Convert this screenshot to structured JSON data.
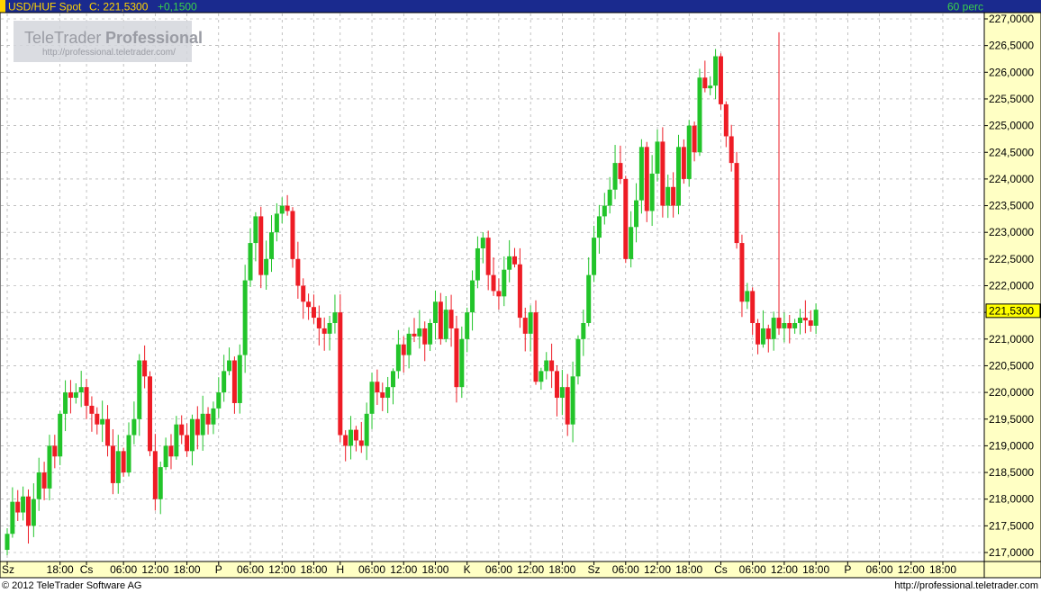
{
  "header": {
    "symbol": "USD/HUF Spot",
    "close_label": "C: 221,5300",
    "change": "+0,1500",
    "interval": "60 perc"
  },
  "watermark": {
    "brand_regular": "TeleTrader",
    "brand_bold": "Professional",
    "url": "http://professional.teletrader.com/"
  },
  "footer": {
    "copyright": "© 2012 TeleTrader Software AG",
    "url": "http://professional.teletrader.com"
  },
  "colors": {
    "header_bg": "#1a2a8e",
    "header_symbol": "#ffd400",
    "header_change": "#3ad14a",
    "axis_bg": "#ffffc4",
    "up": "#22c42a",
    "down": "#ee1c25",
    "price_label_bg": "#ffff00"
  },
  "chart_data": {
    "type": "candlestick",
    "y_min": 216.8,
    "y_max": 227.1,
    "grid": true,
    "last_price": 221.53,
    "last_price_label": "221,5300",
    "y_ticks": [
      {
        "value": 217.0,
        "label": "217,0000"
      },
      {
        "value": 217.5,
        "label": "217,5000"
      },
      {
        "value": 218.0,
        "label": "218,0000"
      },
      {
        "value": 218.5,
        "label": "218,5000"
      },
      {
        "value": 219.0,
        "label": "219,0000"
      },
      {
        "value": 219.5,
        "label": "219,5000"
      },
      {
        "value": 220.0,
        "label": "220,0000"
      },
      {
        "value": 220.5,
        "label": "220,5000"
      },
      {
        "value": 221.0,
        "label": "221,0000"
      },
      {
        "value": 221.5,
        "label": "221,5000"
      },
      {
        "value": 222.0,
        "label": "222,0000"
      },
      {
        "value": 222.5,
        "label": "222,5000"
      },
      {
        "value": 223.0,
        "label": "223,0000"
      },
      {
        "value": 223.5,
        "label": "223,5000"
      },
      {
        "value": 224.0,
        "label": "224,0000"
      },
      {
        "value": 224.5,
        "label": "224,5000"
      },
      {
        "value": 225.0,
        "label": "225,0000"
      },
      {
        "value": 225.5,
        "label": "225,5000"
      },
      {
        "value": 226.0,
        "label": "226,0000"
      },
      {
        "value": 226.5,
        "label": "226,5000"
      },
      {
        "value": 227.0,
        "label": "227,0000"
      }
    ],
    "x_ticks": [
      {
        "index": 0,
        "label": "Sz"
      },
      {
        "index": 10,
        "label": "18:00"
      },
      {
        "index": 15,
        "label": "Cs"
      },
      {
        "index": 22,
        "label": "06:00"
      },
      {
        "index": 28,
        "label": "12:00"
      },
      {
        "index": 34,
        "label": "18:00"
      },
      {
        "index": 40,
        "label": "P"
      },
      {
        "index": 46,
        "label": "06:00"
      },
      {
        "index": 52,
        "label": "12:00"
      },
      {
        "index": 58,
        "label": "18:00"
      },
      {
        "index": 63,
        "label": "H"
      },
      {
        "index": 69,
        "label": "06:00"
      },
      {
        "index": 75,
        "label": "12:00"
      },
      {
        "index": 81,
        "label": "18:00"
      },
      {
        "index": 87,
        "label": "K"
      },
      {
        "index": 93,
        "label": "06:00"
      },
      {
        "index": 99,
        "label": "12:00"
      },
      {
        "index": 105,
        "label": "18:00"
      },
      {
        "index": 111,
        "label": "Sz"
      },
      {
        "index": 117,
        "label": "06:00"
      },
      {
        "index": 123,
        "label": "12:00"
      },
      {
        "index": 129,
        "label": "18:00"
      },
      {
        "index": 135,
        "label": "Cs"
      },
      {
        "index": 141,
        "label": "06:00"
      },
      {
        "index": 147,
        "label": "12:00"
      },
      {
        "index": 153,
        "label": "18:00"
      },
      {
        "index": 159,
        "label": "P"
      },
      {
        "index": 165,
        "label": "06:00"
      },
      {
        "index": 171,
        "label": "12:00"
      },
      {
        "index": 177,
        "label": "18:00"
      }
    ],
    "closes": [
      217.35,
      217.95,
      217.75,
      218.05,
      217.5,
      218.0,
      218.5,
      218.2,
      219.0,
      218.8,
      219.6,
      220.0,
      219.9,
      220.0,
      220.1,
      219.75,
      219.6,
      219.4,
      219.5,
      219.0,
      218.3,
      218.9,
      218.5,
      219.2,
      219.5,
      220.6,
      220.3,
      218.9,
      218.0,
      218.6,
      219.0,
      218.8,
      219.4,
      219.2,
      218.9,
      219.5,
      219.2,
      219.6,
      219.4,
      219.7,
      220.0,
      220.4,
      220.6,
      219.8,
      220.7,
      222.1,
      222.8,
      223.3,
      222.2,
      222.5,
      223.0,
      223.35,
      223.5,
      223.4,
      222.5,
      222.0,
      221.7,
      221.6,
      221.4,
      221.2,
      221.1,
      221.3,
      221.5,
      219.2,
      219.0,
      219.3,
      219.1,
      219.0,
      219.6,
      220.2,
      220.0,
      219.9,
      220.1,
      220.4,
      220.9,
      220.7,
      221.1,
      221.05,
      221.2,
      220.9,
      221.3,
      221.7,
      221.0,
      221.55,
      221.2,
      220.1,
      221.0,
      221.5,
      222.1,
      222.7,
      222.9,
      222.2,
      221.9,
      221.8,
      222.3,
      222.55,
      222.4,
      221.4,
      221.1,
      221.5,
      220.2,
      220.4,
      220.6,
      220.4,
      219.9,
      220.1,
      219.4,
      220.3,
      221.0,
      221.3,
      222.2,
      222.9,
      223.3,
      223.5,
      223.8,
      224.3,
      224.0,
      222.5,
      223.1,
      223.6,
      224.6,
      223.4,
      224.1,
      224.7,
      223.5,
      223.85,
      223.5,
      224.6,
      224.0,
      225.0,
      224.5,
      225.9,
      225.7,
      225.75,
      226.3,
      225.4,
      224.8,
      224.3,
      222.8,
      221.7,
      221.9,
      221.3,
      220.9,
      221.2,
      221.0,
      221.4,
      221.2,
      221.3,
      221.2,
      221.3,
      221.4,
      221.35,
      221.25,
      221.55
    ],
    "range_high": 226.75,
    "range_low": 216.95
  }
}
